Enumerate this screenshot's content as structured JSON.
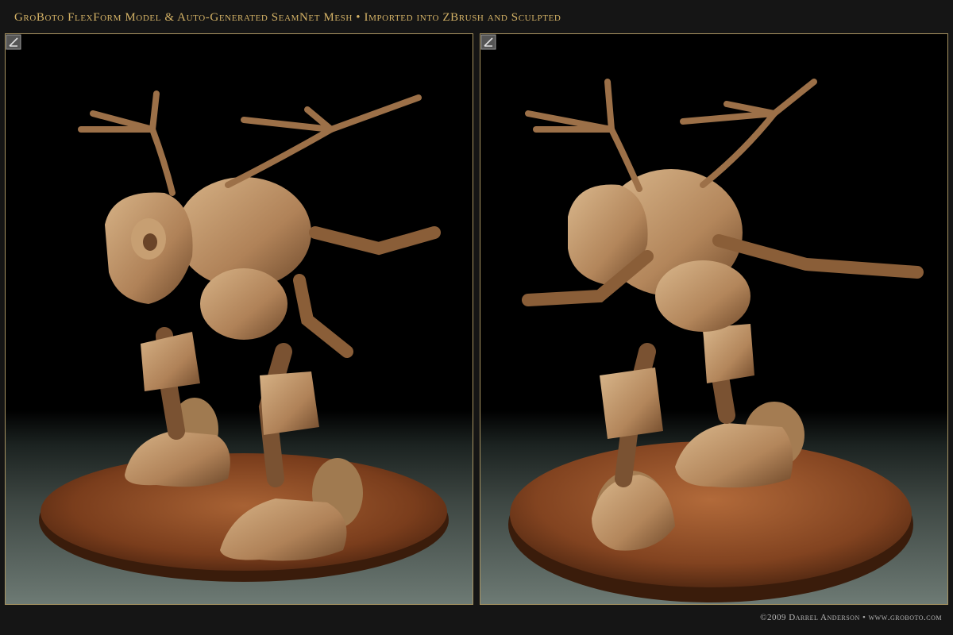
{
  "header": {
    "title": "GroBoto FlexForm Model & Auto-Generated SeamNet Mesh  •  Imported into ZBrush and Sculpted"
  },
  "panels": [
    {
      "id": "left",
      "icon": "zbrush-logo-icon"
    },
    {
      "id": "right",
      "icon": "zbrush-logo-icon"
    }
  ],
  "footer": {
    "credit": "©2009 Darrel Anderson • www.groboto.com"
  },
  "colors": {
    "title": "#d4b266",
    "frame_border": "#a89462",
    "sculpt_clay": "#b98f62",
    "base_clay": "#8a4a22",
    "credit_text": "#b8b8b8"
  }
}
